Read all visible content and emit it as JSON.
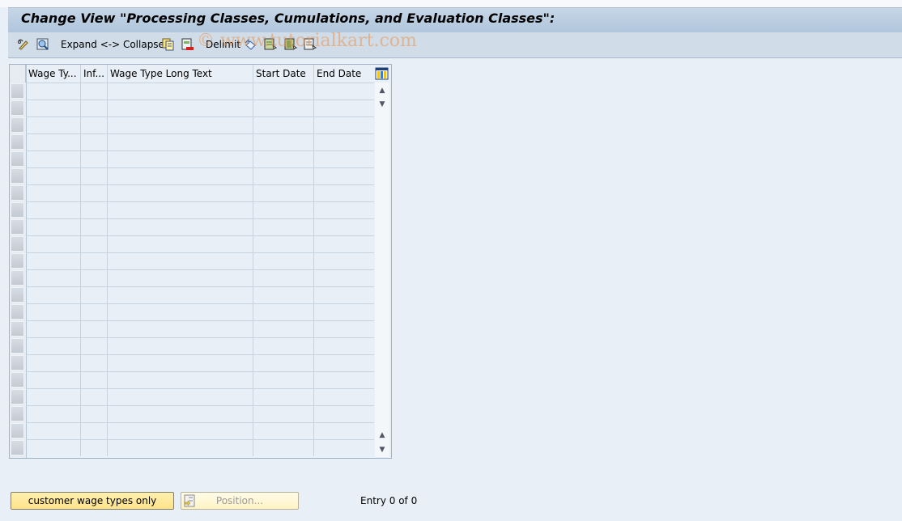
{
  "window": {
    "title": "Change View \"Processing Classes, Cumulations, and Evaluation Classes\":"
  },
  "toolbar": {
    "items": [
      {
        "name": "change-display-button",
        "icon": "pencil-glasses-icon"
      },
      {
        "name": "select-all-button",
        "icon": "details-icon"
      },
      {
        "name": "expand-collapse-button",
        "label": "Expand <-> Collapse"
      },
      {
        "name": "copy-as-button",
        "icon": "copy-icon"
      },
      {
        "name": "delete-button",
        "icon": "delete-row-icon"
      },
      {
        "name": "delimit-button",
        "label": "Delimit"
      },
      {
        "name": "undo-change-button",
        "icon": "undo-icon"
      },
      {
        "name": "select-all-rows-button",
        "icon": "select-all-icon"
      },
      {
        "name": "select-block-button",
        "icon": "select-block-icon"
      },
      {
        "name": "deselect-all-button",
        "icon": "deselect-all-icon"
      }
    ],
    "watermark": "© www.tutorialkart.com"
  },
  "table": {
    "columns": [
      {
        "label": "Wage Ty..."
      },
      {
        "label": "Inf..."
      },
      {
        "label": "Wage Type Long Text"
      },
      {
        "label": "Start Date"
      },
      {
        "label": "End Date"
      }
    ],
    "row_count_visible": 22,
    "rows": []
  },
  "footer": {
    "customer_button": "customer wage types only",
    "position_button": "Position...",
    "entry_text": "Entry 0 of 0"
  },
  "colors": {
    "background": "#e9eff6",
    "titlebar": "#b6cadf",
    "toolbar": "#d0dce7",
    "button_yellow": "#ffe389"
  }
}
